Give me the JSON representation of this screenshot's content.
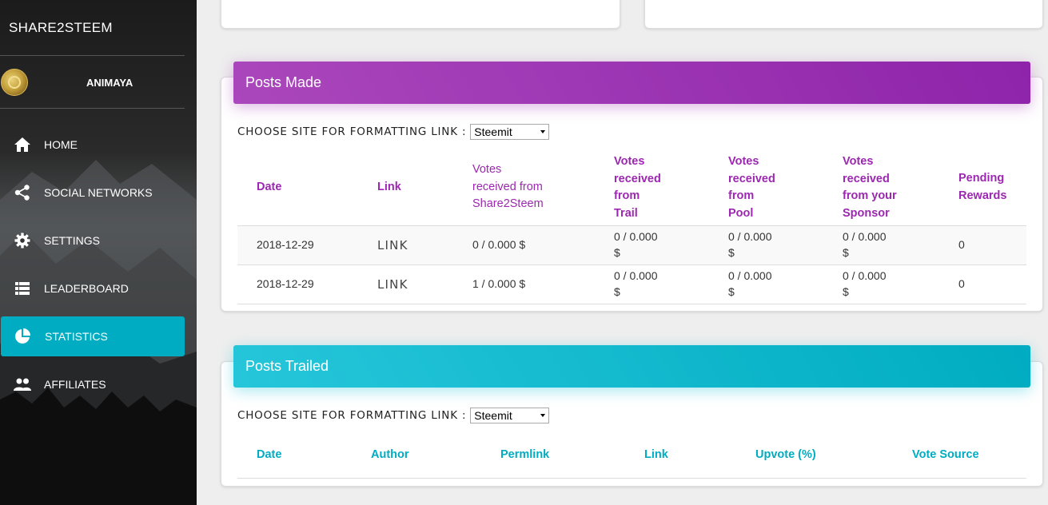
{
  "app": {
    "brand": "SHARE2STEEM",
    "username": "ANIMAYA"
  },
  "nav": [
    {
      "label": "HOME",
      "icon": "home-icon",
      "active": false
    },
    {
      "label": "SOCIAL NETWORKS",
      "icon": "share-icon",
      "active": false
    },
    {
      "label": "SETTINGS",
      "icon": "gear-icon",
      "active": false
    },
    {
      "label": "LEADERBOARD",
      "icon": "list-icon",
      "active": false
    },
    {
      "label": "STATISTICS",
      "icon": "pie-chart-icon",
      "active": true
    },
    {
      "label": "AFFILIATES",
      "icon": "people-icon",
      "active": false
    }
  ],
  "colors": {
    "purple": "#9c27b0",
    "cyan": "#00acc1",
    "active_nav": "#00acc1"
  },
  "posts_made": {
    "title": "Posts Made",
    "choose_label": "CHOOSE SITE FOR FORMATTING LINK :",
    "site_selected": "Steemit",
    "columns": {
      "date": "Date",
      "link": "Link",
      "votes_s2s": [
        "Votes",
        "received from",
        "Share2Steem"
      ],
      "votes_trail": [
        "Votes",
        "received",
        "from",
        "Trail"
      ],
      "votes_pool": [
        "Votes",
        "received",
        "from",
        "Pool"
      ],
      "votes_sponsor": [
        "Votes",
        "received",
        "from your",
        "Sponsor"
      ],
      "pending": [
        "Pending",
        "Rewards"
      ]
    },
    "rows": [
      {
        "date": "2018-12-29",
        "link": "LINK",
        "s2s": "0 / 0.000 $",
        "trail": [
          "0 / 0.000",
          "$"
        ],
        "pool": [
          "0 / 0.000",
          "$"
        ],
        "sponsor": [
          "0 / 0.000",
          "$"
        ],
        "pending": "0"
      },
      {
        "date": "2018-12-29",
        "link": "LINK",
        "s2s": "1 / 0.000 $",
        "trail": [
          "0 / 0.000",
          "$"
        ],
        "pool": [
          "0 / 0.000",
          "$"
        ],
        "sponsor": [
          "0 / 0.000",
          "$"
        ],
        "pending": "0"
      }
    ]
  },
  "posts_trailed": {
    "title": "Posts Trailed",
    "choose_label": "CHOOSE SITE FOR FORMATTING LINK :",
    "site_selected": "Steemit",
    "columns": {
      "date": "Date",
      "author": "Author",
      "permlink": "Permlink",
      "link": "Link",
      "upvote": "Upvote (%)",
      "vote_source": "Vote Source"
    }
  }
}
